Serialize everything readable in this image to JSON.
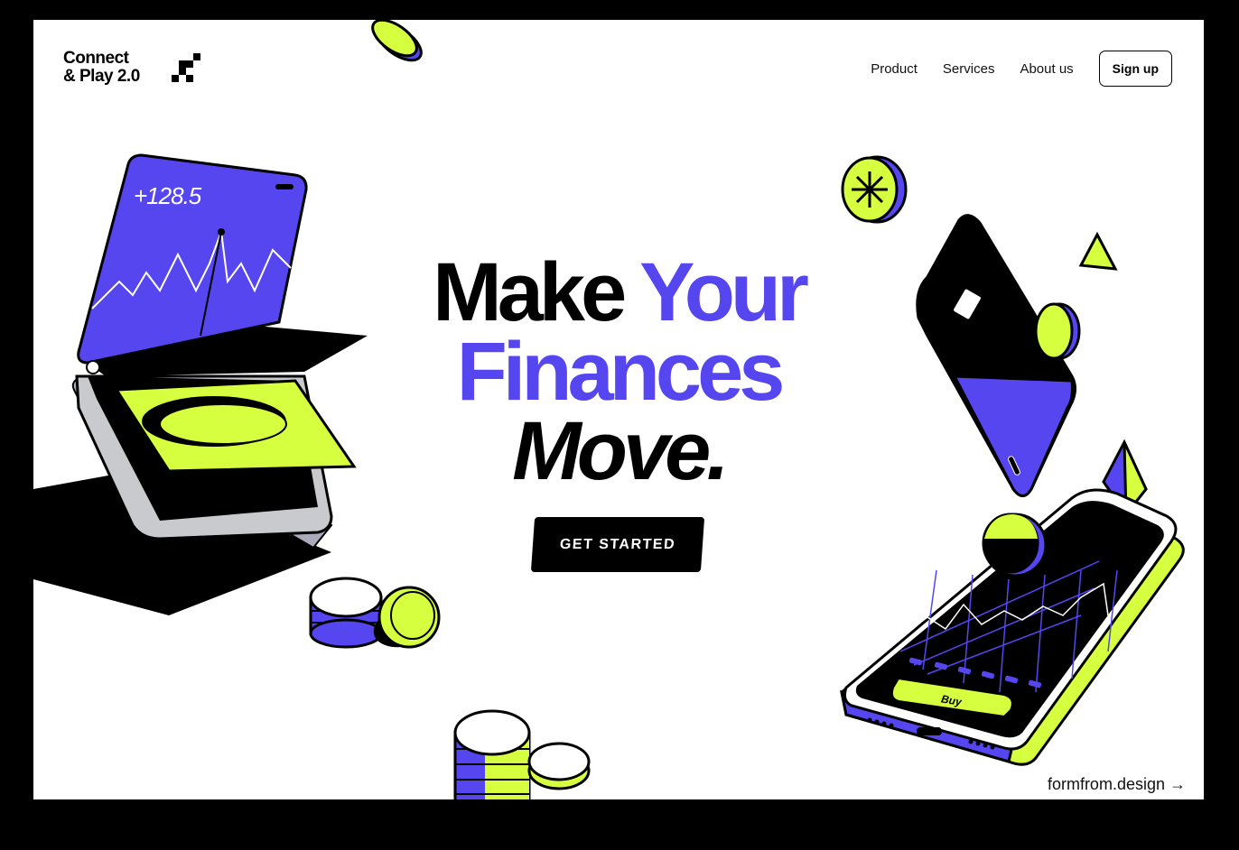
{
  "brand": {
    "line1": "Connect",
    "line2": "& Play 2.0"
  },
  "nav": {
    "items": [
      "Product",
      "Services",
      "About us"
    ],
    "signup": "Sign up"
  },
  "hero": {
    "word1": "Make",
    "word2": "Your",
    "word3": "Finances",
    "word4": "Move."
  },
  "cta": {
    "label": "GET STARTED"
  },
  "tablet": {
    "value": "+128.5"
  },
  "phone": {
    "buy_label": "Buy"
  },
  "footer": {
    "link": "formfrom.design",
    "arrow": "→"
  },
  "colors": {
    "accent_blue": "#5646f0",
    "accent_lime": "#d6ff3f",
    "ink": "#000000",
    "paper": "#ffffff"
  }
}
